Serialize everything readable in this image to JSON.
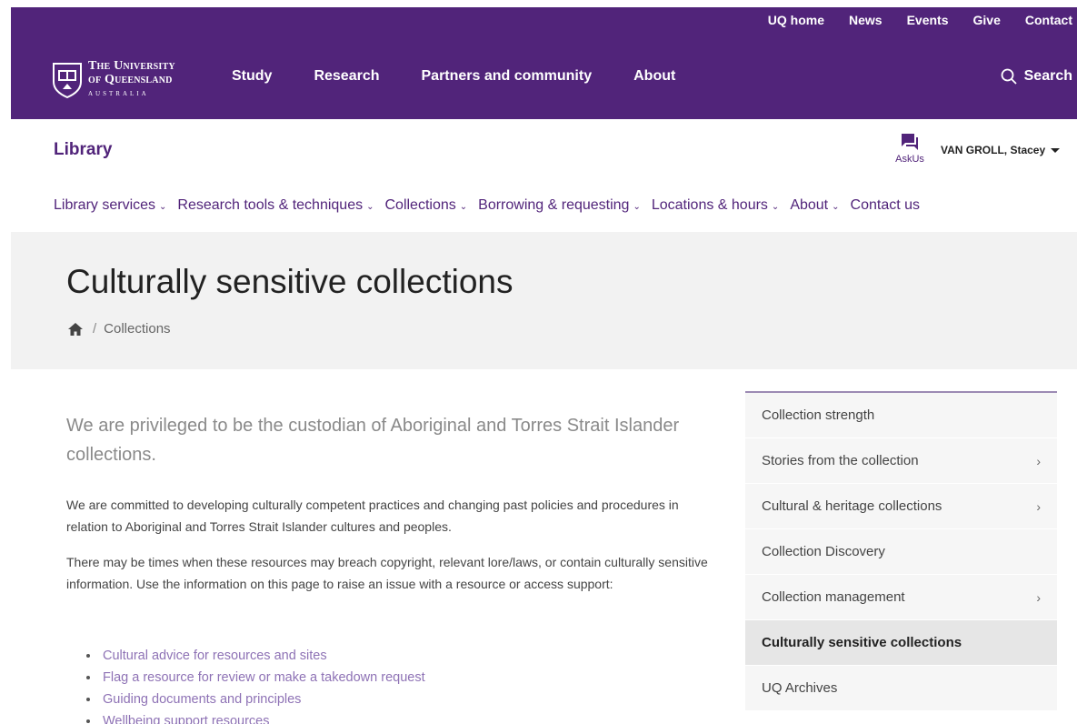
{
  "utility_nav": [
    "UQ home",
    "News",
    "Events",
    "Give",
    "Contact"
  ],
  "logo": {
    "line1": "The University",
    "line2": "of Queensland",
    "line3": "AUSTRALIA"
  },
  "main_nav": [
    "Study",
    "Research",
    "Partners and community",
    "About"
  ],
  "search_label": "Search",
  "library_title": "Library",
  "askus_label": "AskUs",
  "user_name": "VAN GROLL, Stacey",
  "secondary_nav": [
    {
      "label": "Library services",
      "has_dropdown": true
    },
    {
      "label": "Research tools & techniques",
      "has_dropdown": true
    },
    {
      "label": "Collections",
      "has_dropdown": true
    },
    {
      "label": "Borrowing & requesting",
      "has_dropdown": true
    },
    {
      "label": "Locations & hours",
      "has_dropdown": true
    },
    {
      "label": "About",
      "has_dropdown": true
    },
    {
      "label": "Contact us",
      "has_dropdown": false
    }
  ],
  "page_title": "Culturally sensitive collections",
  "breadcrumb": {
    "sep": "/",
    "current": "Collections"
  },
  "intro": "We are privileged to be the custodian of Aboriginal and Torres Strait Islander collections.",
  "paragraphs": [
    "We are committed to developing culturally competent practices and changing past policies and procedures in relation to Aboriginal and Torres Strait Islander cultures and peoples.",
    "There may be times when these resources may breach copyright, relevant lore/laws, or contain culturally sensitive information. Use the information on this page to raise an issue with a resource or access support:"
  ],
  "links": [
    "Cultural advice for resources and sites",
    "Flag a resource for review or make a takedown request",
    "Guiding documents and principles",
    "Wellbeing support resources"
  ],
  "sidebar": [
    {
      "label": "Collection strength",
      "has_children": false,
      "active": false
    },
    {
      "label": "Stories from the collection",
      "has_children": true,
      "active": false
    },
    {
      "label": "Cultural & heritage collections",
      "has_children": true,
      "active": false
    },
    {
      "label": "Collection Discovery",
      "has_children": false,
      "active": false
    },
    {
      "label": "Collection management",
      "has_children": true,
      "active": false
    },
    {
      "label": "Culturally sensitive collections",
      "has_children": false,
      "active": true
    },
    {
      "label": "UQ Archives",
      "has_children": false,
      "active": false
    }
  ],
  "colors": {
    "brand_purple": "#51247a",
    "link_purple": "#8e72b5",
    "hero_bg": "#f2f2f2"
  },
  "icons": {
    "search": "search-icon",
    "askus": "chat-icon",
    "home": "home-icon",
    "user_caret": "caret-down-icon"
  }
}
